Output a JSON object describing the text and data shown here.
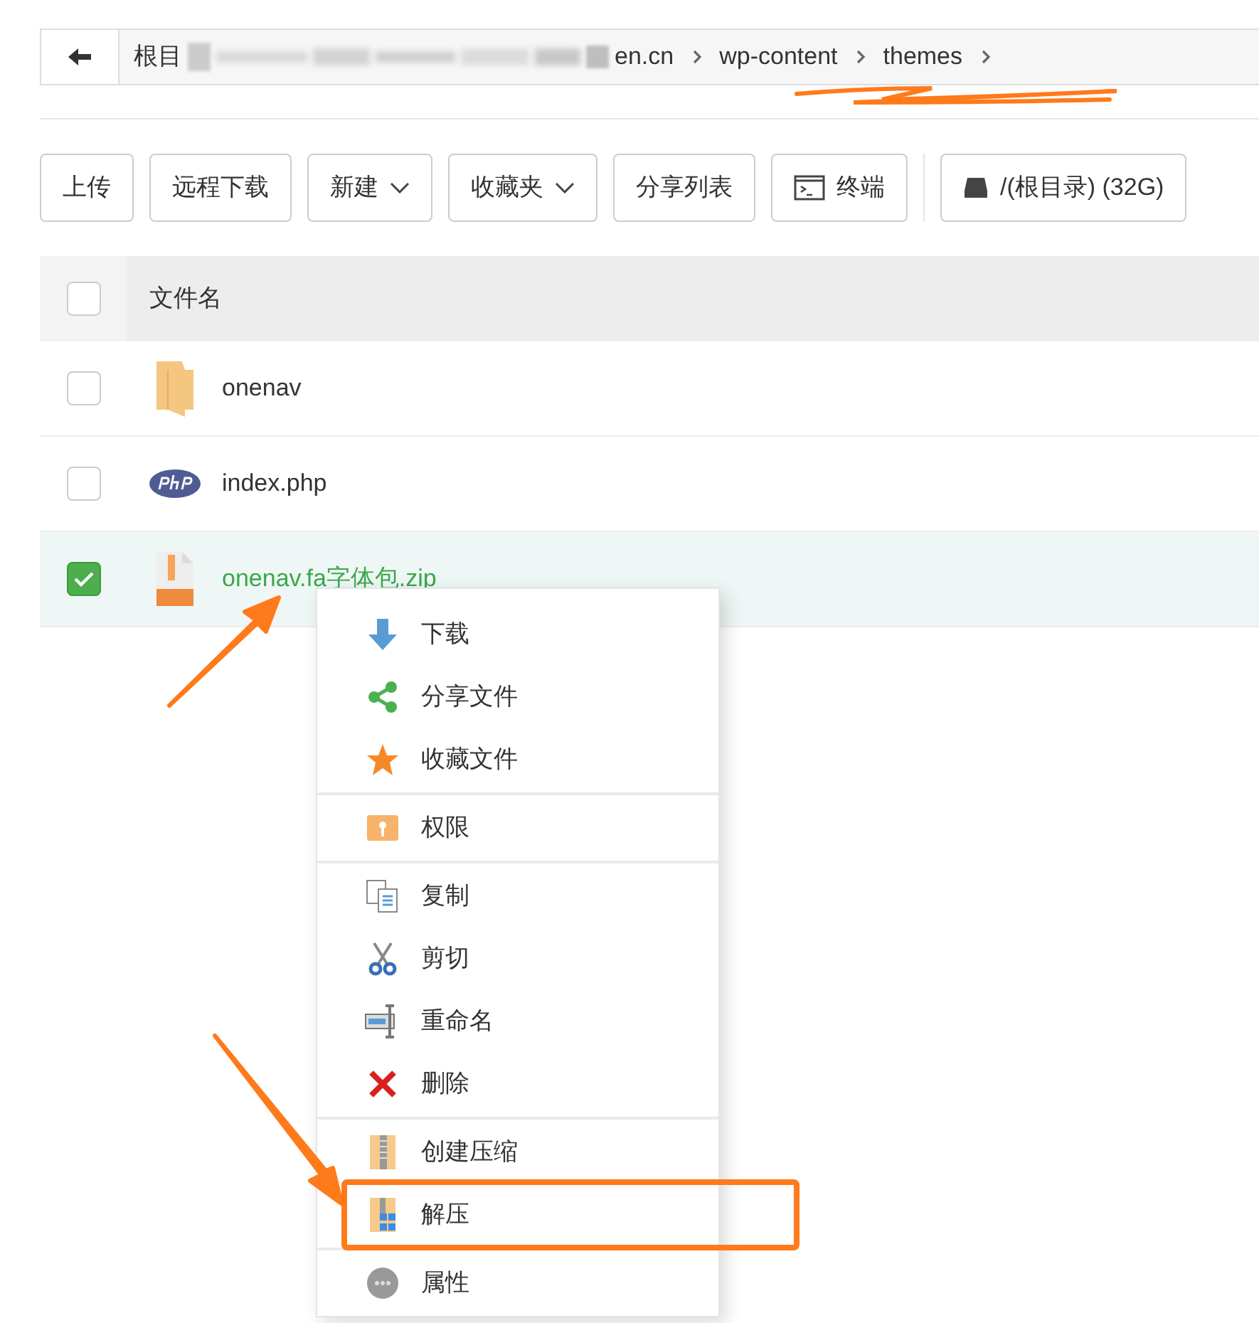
{
  "breadcrumb": {
    "crumbs": [
      {
        "kind": "text",
        "label": "根目"
      },
      {
        "kind": "redacted"
      },
      {
        "kind": "text",
        "label": "en.cn"
      },
      {
        "kind": "text",
        "label": "wp-content"
      },
      {
        "kind": "text",
        "label": "themes"
      }
    ]
  },
  "toolbar": [
    {
      "label": "上传",
      "kind": "plain"
    },
    {
      "label": "远程下载",
      "kind": "plain"
    },
    {
      "label": "新建",
      "kind": "dropdown"
    },
    {
      "label": "收藏夹",
      "kind": "dropdown"
    },
    {
      "label": "分享列表",
      "kind": "plain"
    },
    {
      "label": "终端",
      "kind": "terminal"
    },
    {
      "label": "/(根目录) (32G)",
      "kind": "disk"
    }
  ],
  "table": {
    "header": {
      "label": "文件名",
      "checked": false
    },
    "rows": [
      {
        "name": "onenav",
        "kind": "folder",
        "checked": false,
        "selected": false
      },
      {
        "name": "index.php",
        "kind": "php",
        "checked": false,
        "selected": false
      },
      {
        "name": "onenav.fa字体包.zip",
        "kind": "zip",
        "checked": true,
        "selected": true
      }
    ]
  },
  "context_menu": {
    "groups": [
      [
        {
          "label": "下载",
          "kind": "download"
        },
        {
          "label": "分享文件",
          "kind": "share"
        },
        {
          "label": "收藏文件",
          "kind": "star"
        }
      ],
      [
        {
          "label": "权限",
          "kind": "permission"
        }
      ],
      [
        {
          "label": "复制",
          "kind": "copy"
        },
        {
          "label": "剪切",
          "kind": "cut"
        },
        {
          "label": "重命名",
          "kind": "rename"
        },
        {
          "label": "删除",
          "kind": "delete"
        }
      ],
      [
        {
          "label": "创建压缩",
          "kind": "compress"
        },
        {
          "label": "解压",
          "kind": "extract"
        }
      ],
      [
        {
          "label": "属性",
          "kind": "properties"
        }
      ]
    ]
  }
}
